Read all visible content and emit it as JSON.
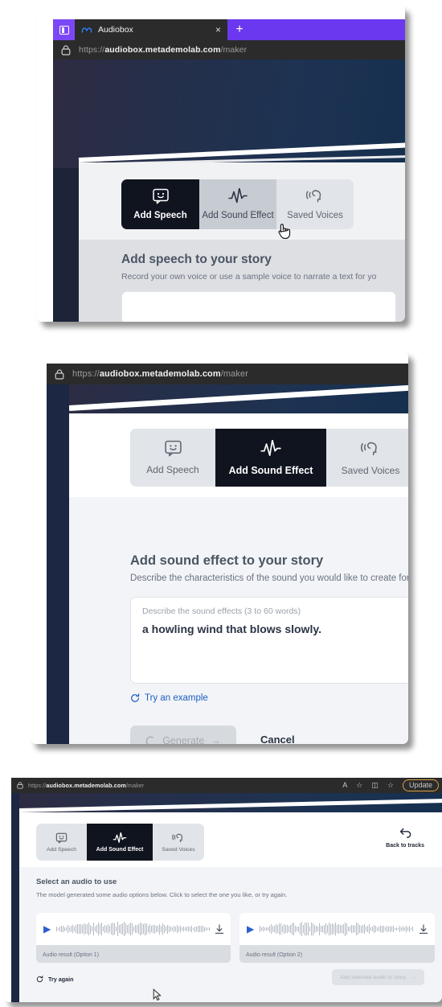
{
  "browser": {
    "tab_title": "Audiobox",
    "tab_close_label": "×",
    "new_tab_label": "+",
    "url_scheme": "https://",
    "url_domain": "audiobox.metademolab.com",
    "url_path": "/maker",
    "edge_toolbar": {
      "read_aloud_icon": "A",
      "favorite_icon": "☆",
      "split_screen_icon": "◫",
      "collections_icon": "☆",
      "update_label": "Update"
    }
  },
  "tabs": [
    {
      "key": "speech",
      "label": "Add Speech",
      "icon": "speech-bubble-smiley-icon"
    },
    {
      "key": "sfx",
      "label": "Add Sound Effect",
      "icon": "waveform-icon"
    },
    {
      "key": "voices",
      "label": "Saved Voices",
      "icon": "speaking-head-icon"
    }
  ],
  "panel1": {
    "active_tab": "speech",
    "section_title": "Add speech to your story",
    "section_sub": "Record your own voice or use a sample voice to narrate a text for yo",
    "cursor": "pointer-hand"
  },
  "panel2": {
    "active_tab": "sfx",
    "section_title": "Add sound effect to your story",
    "section_sub": "Describe the characteristics of the sound you would like to create for y",
    "input_placeholder": "Describe the sound effects (3 to 60 words)",
    "input_value": "a howling wind that blows slowly.",
    "try_example_label": "Try an example",
    "generate_label": "Generate",
    "generate_arrow": "→",
    "cancel_label": "Cancel"
  },
  "panel3": {
    "active_tab": "sfx",
    "back_to_tracks_label": "Back to tracks",
    "section_title": "Select an audio to use",
    "section_sub": "The model generated some audio options below. Click to select the one you like, or try again.",
    "audio_results": [
      {
        "caption": "Audio result (Option 1)",
        "play_label": "▶",
        "download_icon": "download-icon"
      },
      {
        "caption": "Audio result (Option 2)",
        "play_label": "▶",
        "download_icon": "download-icon"
      }
    ],
    "try_again_label": "Try again",
    "add_audio_label": "Add selected audio to story",
    "add_audio_arrow": "→",
    "cursor": "arrow"
  },
  "colors": {
    "accent_purple": "#6b38ef",
    "chrome_dark": "#2b2b2b",
    "tab_active_dark": "#10141f",
    "hero_navy": "#1d3252",
    "link_blue": "#1f5fc4",
    "play_blue": "#2c5fd0",
    "card_bg": "#f1f2f4"
  }
}
